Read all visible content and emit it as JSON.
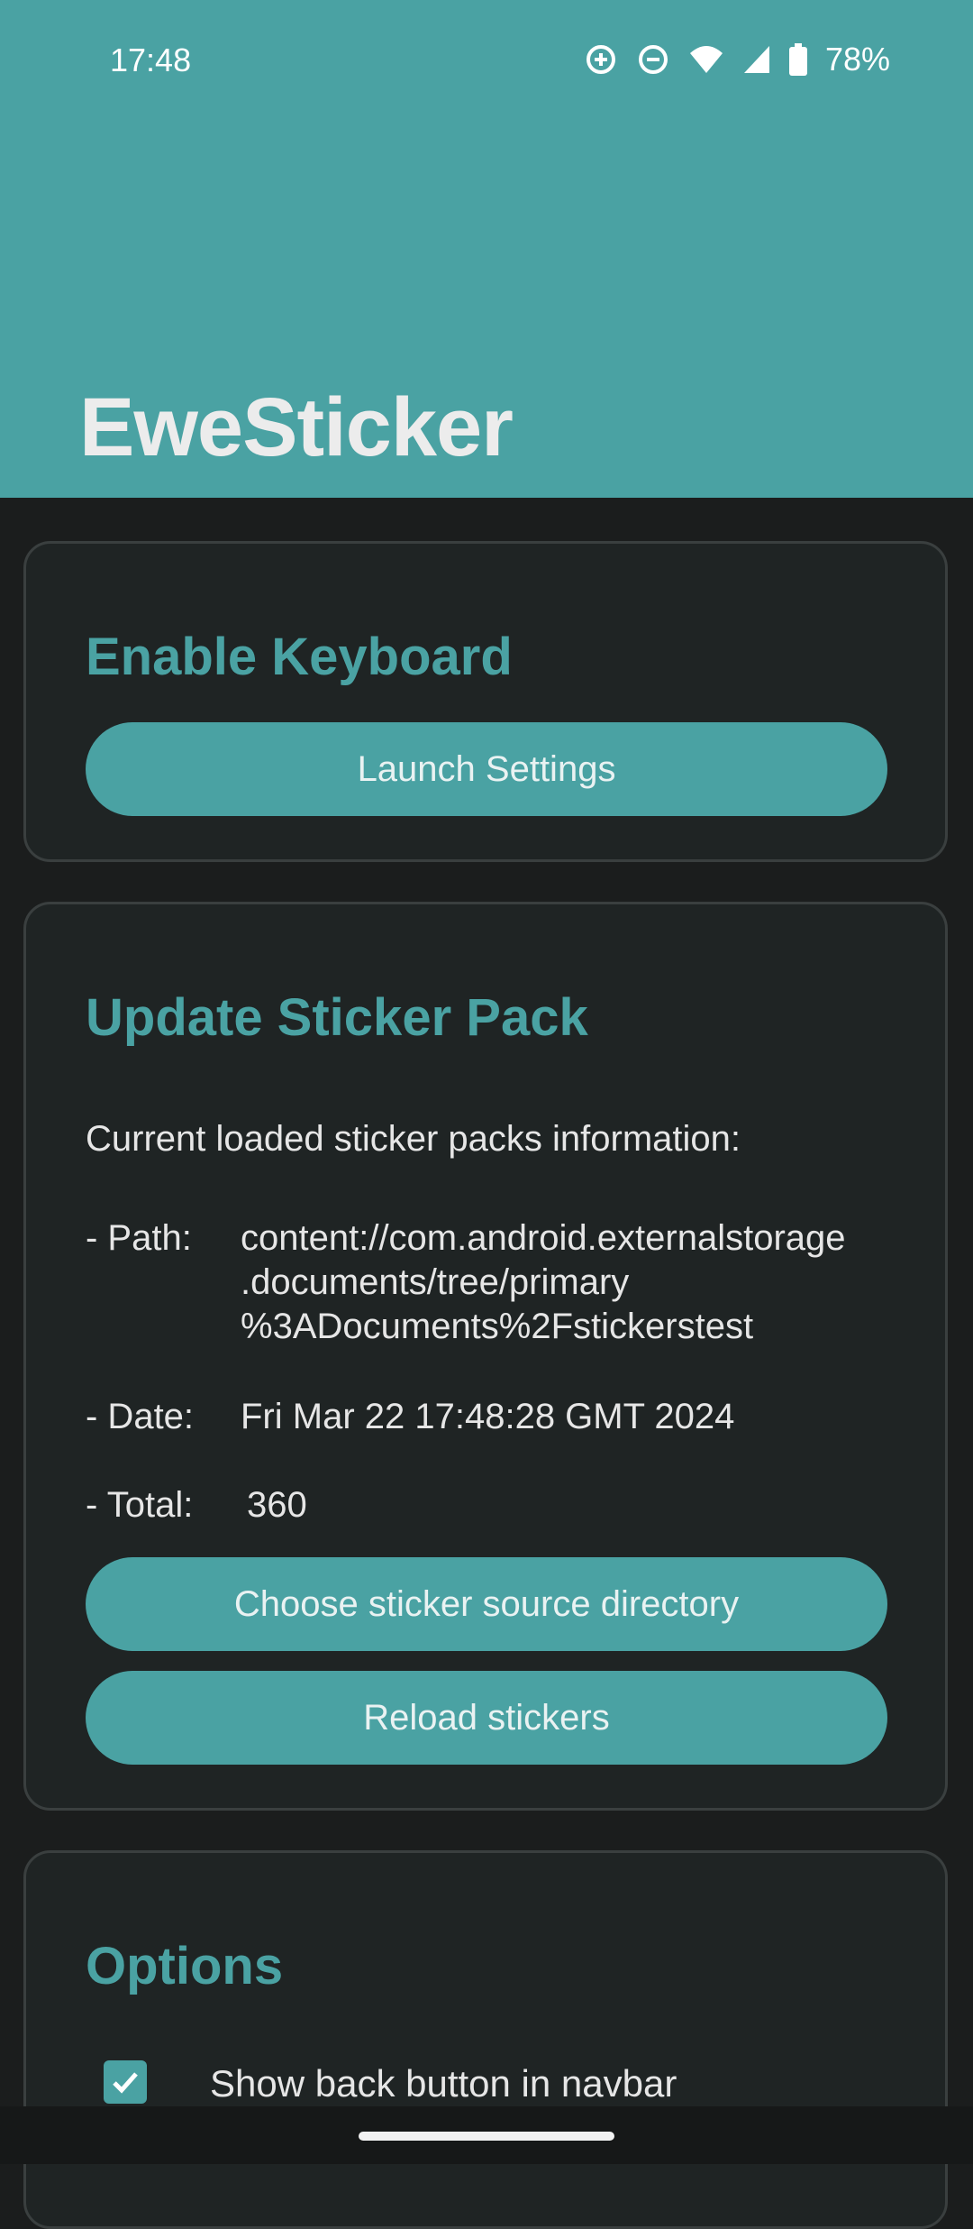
{
  "status_bar": {
    "time": "17:48",
    "battery": "78%",
    "icons": [
      "data-saver-icon",
      "do-not-disturb-icon",
      "wifi-icon",
      "signal-icon",
      "battery-icon"
    ]
  },
  "app": {
    "title": "EweSticker",
    "accent_color": "#4aa2a3"
  },
  "enable_keyboard": {
    "title": "Enable Keyboard",
    "button_label": "Launch Settings"
  },
  "update_sticker_pack": {
    "title": "Update Sticker Pack",
    "info_heading": "Current loaded sticker packs information:",
    "path_label": "- Path:",
    "path_lines": [
      "content://com.android.externalstorage",
      ".documents/tree/primary",
      "%3ADocuments%2Fstickerstest"
    ],
    "date_label": "- Date:",
    "date_value": "Fri Mar 22 17:48:28 GMT 2024",
    "total_label": "- Total:",
    "total_value": "360",
    "choose_button_label": "Choose sticker source directory",
    "reload_button_label": "Reload stickers"
  },
  "options": {
    "title": "Options",
    "items": [
      {
        "label": "Show back button in navbar",
        "checked": true
      }
    ]
  }
}
